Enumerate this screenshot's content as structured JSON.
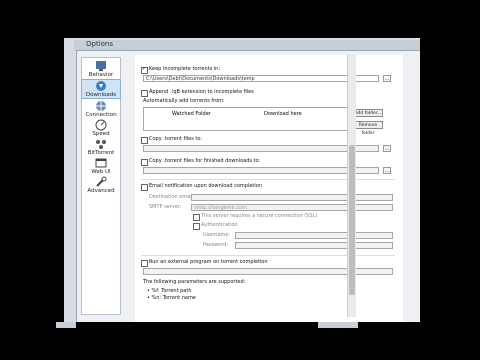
{
  "window": {
    "title": "Options"
  },
  "sidebar": {
    "items": [
      {
        "label": "Behavior",
        "icon": "behavior-icon"
      },
      {
        "label": "Downloads",
        "icon": "downloads-icon",
        "selected": true
      },
      {
        "label": "Connection",
        "icon": "connection-icon"
      },
      {
        "label": "Speed",
        "icon": "speed-icon"
      },
      {
        "label": "BitTorrent",
        "icon": "bittorrent-icon"
      },
      {
        "label": "Web UI",
        "icon": "webui-icon"
      },
      {
        "label": "Advanced",
        "icon": "advanced-icon"
      }
    ]
  },
  "downloads": {
    "keep_incomplete_label": "Keep incomplete torrents in:",
    "keep_incomplete_path": "C:\\Users\\Debt\\Documents\\Downloads\\temp",
    "append_label": "Append .!qB extension to incomplete files",
    "auto_add_label": "Automatically add torrents from:",
    "col_watched": "Watched Folder",
    "col_download": "Download here",
    "add_folder_btn": "Add folder...",
    "remove_folder_btn": "Remove folder",
    "copy_torrent_label": "Copy .torrent files to:",
    "copy_finished_label": "Copy .torrent files for finished downloads to:",
    "email_label": "Email notification upon download completion",
    "destination_email_label": "Destination email:",
    "smtp_label": "SMTP server:",
    "smtp_value": "smtp.changeme.com",
    "ssl_label": "This server requires a secure connection (SSL)",
    "auth_label": "Authentication",
    "username_label": "Username:",
    "password_label": "Password:",
    "run_label": "Run an external program on torrent completion",
    "params_label": "The following parameters are supported:",
    "param_path": "• %f: Torrent path",
    "param_name": "• %n: Torrent name"
  }
}
